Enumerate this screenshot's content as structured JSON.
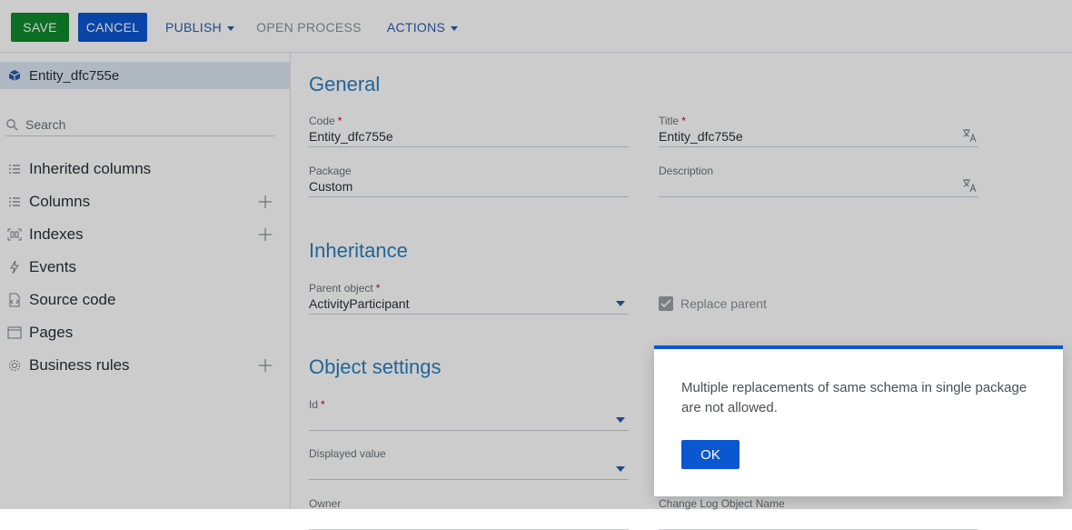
{
  "toolbar": {
    "save": "SAVE",
    "cancel": "CANCEL",
    "publish": "PUBLISH",
    "open_process": "OPEN PROCESS",
    "actions": "ACTIONS"
  },
  "sidebar": {
    "entity_name": "Entity_dfc755e",
    "search_placeholder": "Search",
    "items": [
      {
        "label": "Inherited columns",
        "icon": "columns-icon",
        "has_add": false
      },
      {
        "label": "Columns",
        "icon": "columns-icon",
        "has_add": true
      },
      {
        "label": "Indexes",
        "icon": "indexes-icon",
        "has_add": true
      },
      {
        "label": "Events",
        "icon": "lightning-icon",
        "has_add": false
      },
      {
        "label": "Source code",
        "icon": "code-icon",
        "has_add": false
      },
      {
        "label": "Pages",
        "icon": "page-icon",
        "has_add": false
      },
      {
        "label": "Business rules",
        "icon": "gear-icon",
        "has_add": true
      }
    ]
  },
  "main": {
    "general_title": "General",
    "code_label": "Code",
    "code_value": "Entity_dfc755e",
    "title_label": "Title",
    "title_value": "Entity_dfc755e",
    "package_label": "Package",
    "package_value": "Custom",
    "description_label": "Description",
    "description_value": "",
    "inheritance_title": "Inheritance",
    "parent_label": "Parent object",
    "parent_value": "ActivityParticipant",
    "replace_parent": "Replace parent",
    "object_settings_title": "Object settings",
    "id_label": "Id",
    "displayed_value_label": "Displayed value",
    "owner_label": "Owner",
    "change_log_label": "Change Log Object Name"
  },
  "dialog": {
    "message": "Multiple replacements of same schema in single package are not allowed.",
    "ok": "OK"
  },
  "colors": {
    "save_green": "#0e8a2b",
    "primary_blue": "#0b57d0",
    "section_blue": "#2a7fc0",
    "required_red": "#d0011b"
  }
}
